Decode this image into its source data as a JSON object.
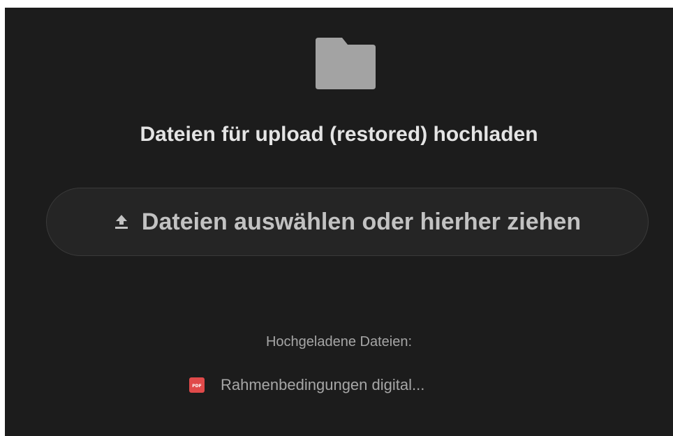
{
  "header": {
    "icon": "folder-icon",
    "title": "Dateien für upload (restored) hochladen"
  },
  "upload": {
    "icon": "upload-icon",
    "label": "Dateien auswählen oder hierher ziehen"
  },
  "uploaded": {
    "heading": "Hochgeladene Dateien:",
    "files": [
      {
        "icon": "pdf-file-icon",
        "icon_text": "PDF",
        "name": "Rahmenbedingungen digital..."
      }
    ]
  },
  "colors": {
    "background": "#1c1c1c",
    "folder": "#a3a3a3",
    "pdf_badge": "#e04a4a"
  }
}
